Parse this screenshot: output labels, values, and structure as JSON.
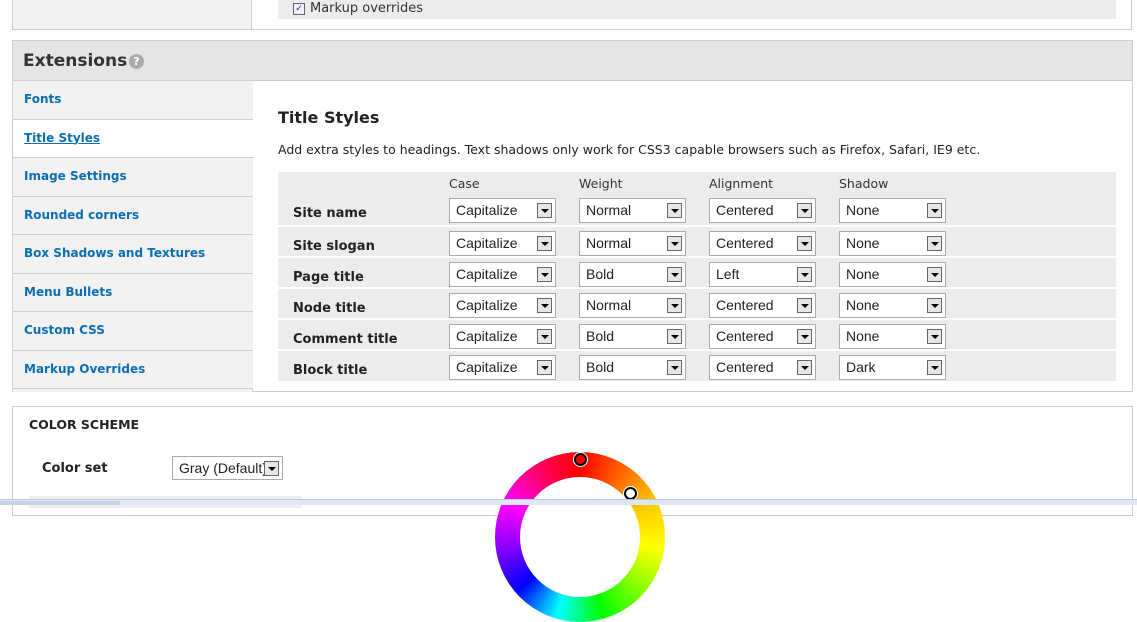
{
  "top": {
    "checkbox_label": "Markup overrides",
    "checked": true
  },
  "extensions": {
    "title": "Extensions",
    "help": "?",
    "sidebar": [
      {
        "label": "Fonts"
      },
      {
        "label": "Title Styles",
        "active": true
      },
      {
        "label": "Image Settings"
      },
      {
        "label": "Rounded corners"
      },
      {
        "label": "Box Shadows and Textures"
      },
      {
        "label": "Menu Bullets"
      },
      {
        "label": "Custom CSS"
      },
      {
        "label": "Markup Overrides"
      }
    ],
    "content": {
      "title": "Title Styles",
      "description": "Add extra styles to headings. Text shadows only work for CSS3 capable browsers such as Firefox, Safari, IE9 etc.",
      "columns": [
        "Case",
        "Weight",
        "Alignment",
        "Shadow"
      ],
      "rows": [
        {
          "label": "Site name",
          "values": [
            "Capitalize",
            "Normal",
            "Centered",
            "None"
          ]
        },
        {
          "label": "Site slogan",
          "values": [
            "Capitalize",
            "Normal",
            "Centered",
            "None"
          ]
        },
        {
          "label": "Page title",
          "values": [
            "Capitalize",
            "Bold",
            "Left",
            "None"
          ]
        },
        {
          "label": "Node title",
          "values": [
            "Capitalize",
            "Normal",
            "Centered",
            "None"
          ]
        },
        {
          "label": "Comment title",
          "values": [
            "Capitalize",
            "Bold",
            "Centered",
            "None"
          ]
        },
        {
          "label": "Block title",
          "values": [
            "Capitalize",
            "Bold",
            "Centered",
            "Dark"
          ]
        }
      ]
    }
  },
  "color_scheme": {
    "title": "COLOR SCHEME",
    "color_set_label": "Color set",
    "color_set_value": "Gray (Default)"
  }
}
